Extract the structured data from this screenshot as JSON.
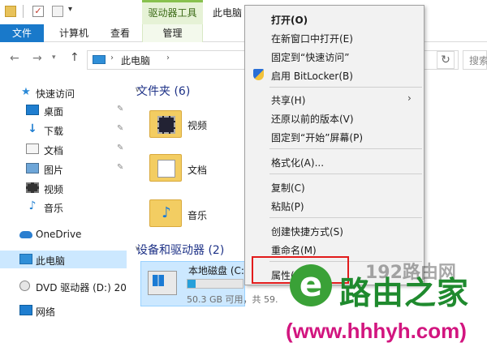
{
  "title_bar": {
    "context_tab_group": "驱动器工具",
    "window_title": "此电脑"
  },
  "ribbon": {
    "tabs": [
      "文件",
      "计算机",
      "查看",
      "管理"
    ]
  },
  "address": {
    "path": "此电脑",
    "search_placeholder": "搜索"
  },
  "nav": {
    "quick_access": "快速访问",
    "pinned": [
      "桌面",
      "下载",
      "文档",
      "图片"
    ],
    "unpinned": [
      "视频",
      "音乐"
    ],
    "onedrive": "OneDrive",
    "this_pc": "此电脑",
    "dvd": "DVD 驱动器 (D:) 20",
    "network": "网络"
  },
  "content": {
    "folders_header": "文件夹 (6)",
    "folders": [
      "视频",
      "文档",
      "音乐"
    ],
    "devices_header": "设备和驱动器 (2)",
    "drive": {
      "name": "本地磁盘 (C:",
      "free_text": "50.3 GB 可用，共 59.",
      "used_fraction": 0.15
    }
  },
  "context_menu": {
    "items": [
      {
        "label": "打开(O)",
        "bold": true
      },
      {
        "label": "在新窗口中打开(E)"
      },
      {
        "label": "固定到“快速访问”"
      },
      {
        "label": "启用 BitLocker(B)",
        "icon": "shield-icon"
      },
      {
        "label": "共享(H)",
        "submenu": true
      },
      {
        "label": "还原以前的版本(V)"
      },
      {
        "label": "固定到“开始”屏幕(P)"
      },
      {
        "label": "格式化(A)..."
      },
      {
        "label": "复制(C)"
      },
      {
        "label": "粘贴(P)"
      },
      {
        "label": "创建快捷方式(S)"
      },
      {
        "label": "重命名(M)"
      },
      {
        "label": "属性(R)"
      }
    ]
  },
  "watermark": {
    "logo_glyph": "e",
    "brand": "路由之家",
    "ghost": "192路由网",
    "url": "(www.hhhyh.com)"
  },
  "colors": {
    "file_tab": "#1979ca",
    "selection": "#cce8ff",
    "highlight_box": "#e21b1b",
    "watermark_green": "#1f8a2e",
    "watermark_url": "#d2157f"
  }
}
